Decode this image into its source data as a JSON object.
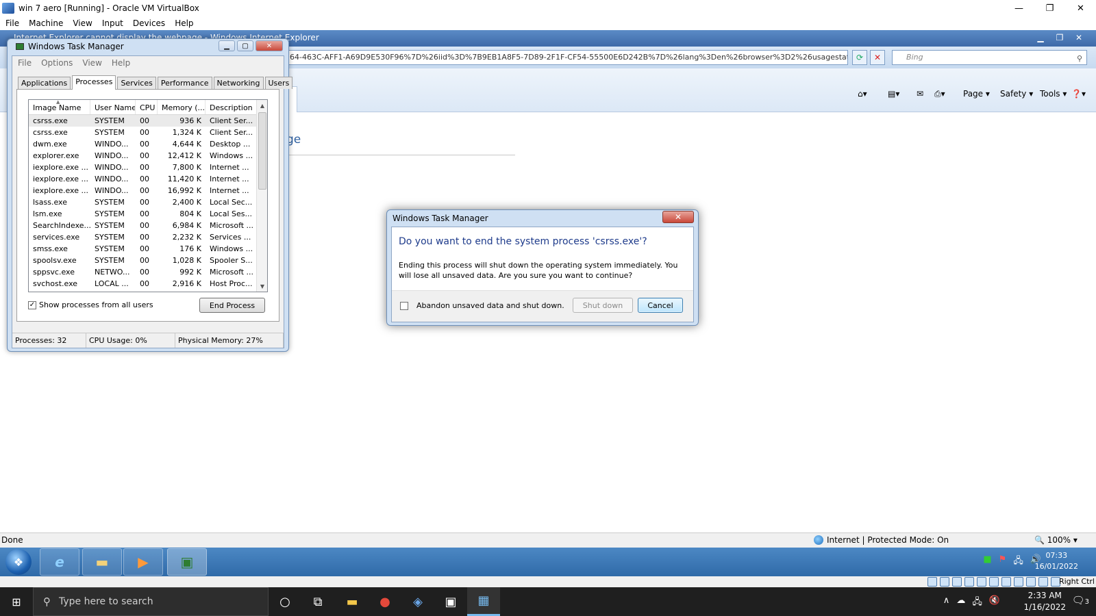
{
  "vbox": {
    "title": "win 7 aero [Running] - Oracle VM VirtualBox",
    "menu": [
      "File",
      "Machine",
      "View",
      "Input",
      "Devices",
      "Help"
    ],
    "right_ctrl": "Right Ctrl"
  },
  "ie": {
    "window_title": "Internet Explorer cannot display the webpage - Windows Internet Explorer",
    "address": "64-463C-AFF1-A69D9E530F96%7D%26iid%3D%7B9EB1A8F5-7D89-2F1F-CF54-55500E6D242B%7D%26lang%3Den%26browser%3D2%26usagestats%3D1%",
    "search_placeholder": "Bing",
    "commands": {
      "page": "Page ▾",
      "safety": "Safety ▾",
      "tools": "Tools ▾",
      "help": "❓▾"
    },
    "body_title_fragment": "ge",
    "status_left": "Done",
    "status_zone": "Internet | Protected Mode: On",
    "zoom": "🔍 100%  ▾"
  },
  "guest_taskbar": {
    "clock_time": "07:33",
    "clock_date": "16/01/2022"
  },
  "task_manager": {
    "title": "Windows Task Manager",
    "menu": [
      "File",
      "Options",
      "View",
      "Help"
    ],
    "tabs": [
      "Applications",
      "Processes",
      "Services",
      "Performance",
      "Networking",
      "Users"
    ],
    "active_tab": "Processes",
    "columns": [
      "Image Name",
      "User Name",
      "CPU",
      "Memory (...",
      "Description"
    ],
    "rows": [
      [
        "csrss.exe",
        "SYSTEM",
        "00",
        "936 K",
        "Client Ser..."
      ],
      [
        "csrss.exe",
        "SYSTEM",
        "00",
        "1,324 K",
        "Client Ser..."
      ],
      [
        "dwm.exe",
        "WINDO...",
        "00",
        "4,644 K",
        "Desktop ..."
      ],
      [
        "explorer.exe",
        "WINDO...",
        "00",
        "12,412 K",
        "Windows ..."
      ],
      [
        "iexplore.exe ...",
        "WINDO...",
        "00",
        "7,800 K",
        "Internet ..."
      ],
      [
        "iexplore.exe ...",
        "WINDO...",
        "00",
        "11,420 K",
        "Internet ..."
      ],
      [
        "iexplore.exe ...",
        "WINDO...",
        "00",
        "16,992 K",
        "Internet ..."
      ],
      [
        "lsass.exe",
        "SYSTEM",
        "00",
        "2,400 K",
        "Local Sec..."
      ],
      [
        "lsm.exe",
        "SYSTEM",
        "00",
        "804 K",
        "Local Ses..."
      ],
      [
        "SearchIndexe...",
        "SYSTEM",
        "00",
        "6,984 K",
        "Microsoft ..."
      ],
      [
        "services.exe",
        "SYSTEM",
        "00",
        "2,232 K",
        "Services ..."
      ],
      [
        "smss.exe",
        "SYSTEM",
        "00",
        "176 K",
        "Windows ..."
      ],
      [
        "spoolsv.exe",
        "SYSTEM",
        "00",
        "1,028 K",
        "Spooler S..."
      ],
      [
        "sppsvc.exe",
        "NETWO...",
        "00",
        "992 K",
        "Microsoft ..."
      ],
      [
        "svchost.exe",
        "LOCAL ...",
        "00",
        "2,916 K",
        "Host Proc..."
      ]
    ],
    "show_all_label": "Show processes from all users",
    "show_all_checked": "✓",
    "end_process_label": "End Process",
    "status": {
      "processes": "Processes: 32",
      "cpu": "CPU Usage: 0%",
      "memory": "Physical Memory: 27%"
    }
  },
  "dialog": {
    "title": "Windows Task Manager",
    "heading": "Do you want to end the system process 'csrss.exe'?",
    "message": "Ending this process will shut down the operating system immediately.  You will lose all unsaved data.  Are you sure you want to continue?",
    "checkbox_label": "Abandon unsaved data and shut down.",
    "shutdown_label": "Shut down",
    "cancel_label": "Cancel"
  },
  "host_taskbar": {
    "search_placeholder": "Type here to search",
    "time": "2:33 AM",
    "date": "1/16/2022",
    "notification_count": "3"
  }
}
